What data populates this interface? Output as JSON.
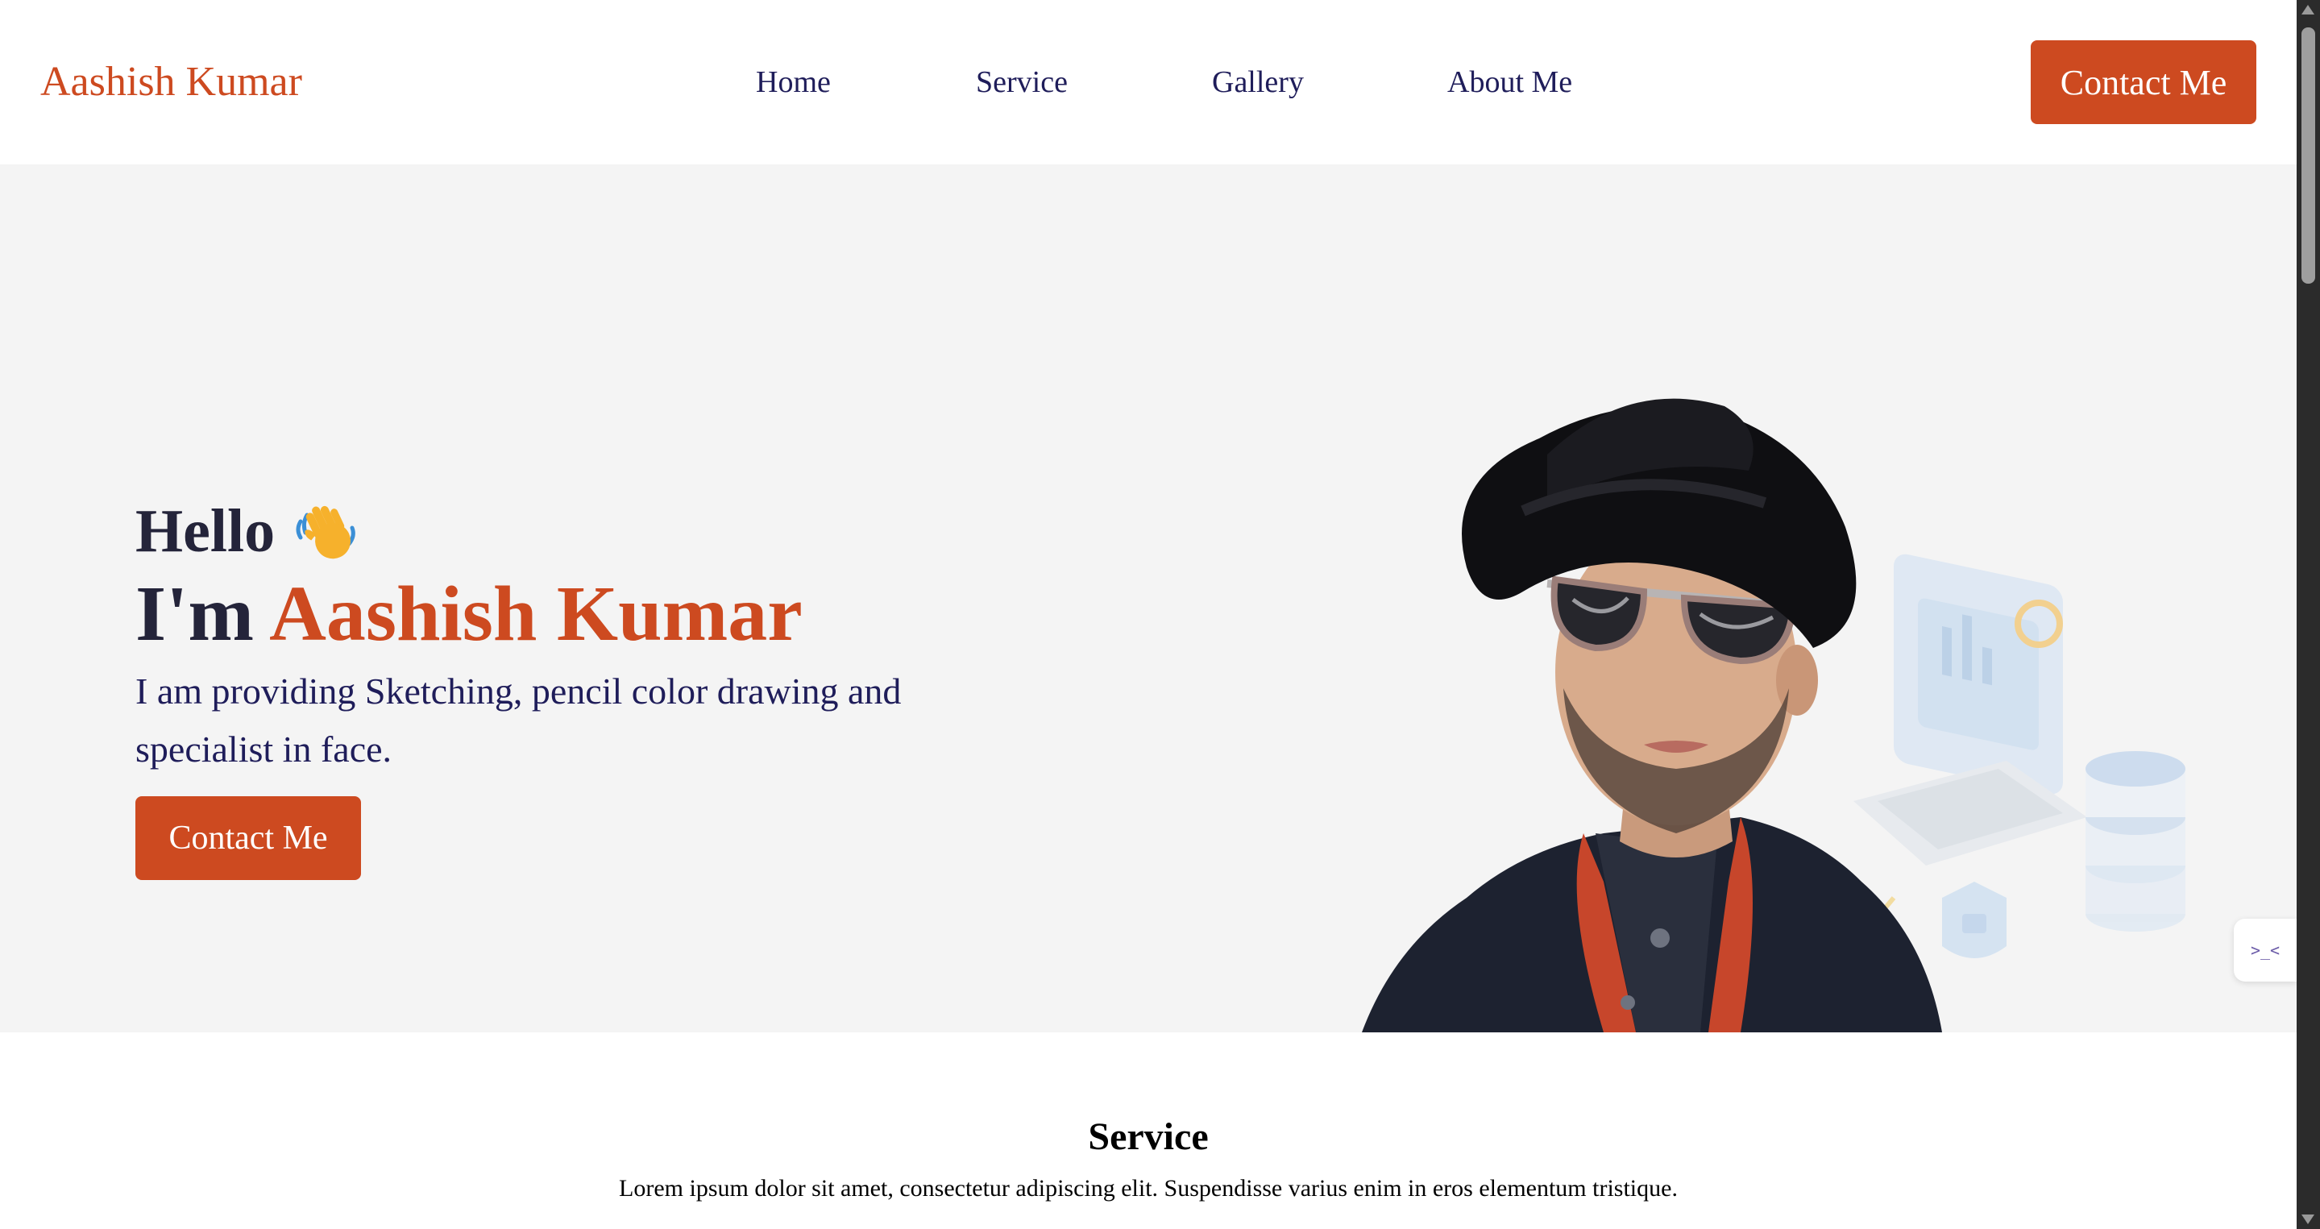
{
  "brand": {
    "name": "Aashish Kumar",
    "accent_color": "#cd4a20",
    "text_dark": "#24243a",
    "nav_text": "#1f1d5a"
  },
  "nav": {
    "links": [
      {
        "label": "Home"
      },
      {
        "label": "Service"
      },
      {
        "label": "Gallery"
      },
      {
        "label": "About Me"
      }
    ],
    "cta_label": "Contact Me"
  },
  "hero": {
    "greeting": "Hello",
    "greeting_icon": "waving-hand-icon",
    "intro_prefix": "I'm ",
    "name": "Aashish Kumar",
    "tagline": "I am providing Sketching, pencil color drawing and specialist in face.",
    "cta_label": "Contact Me",
    "portrait_icon": "portrait-illustration",
    "widget_label": ">_<"
  },
  "service": {
    "title": "Service",
    "description": "Lorem ipsum dolor sit amet, consectetur adipiscing elit. Suspendisse varius enim in eros elementum tristique."
  }
}
